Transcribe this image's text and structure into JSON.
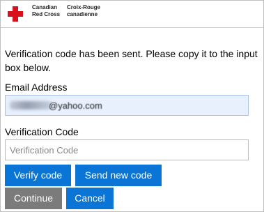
{
  "header": {
    "logo_line1_en": "Canadian",
    "logo_line2_en": "Red Cross",
    "logo_line1_fr": "Croix-Rouge",
    "logo_line2_fr": "canadienne",
    "logo_color": "#d6131b"
  },
  "message": "Verification code has been sent. Please copy it to the input box below.",
  "email": {
    "label": "Email Address",
    "value_visible": "@yahoo.com"
  },
  "verification": {
    "label": "Verification Code",
    "placeholder": "Verification Code",
    "value": ""
  },
  "buttons": {
    "verify_label": "Verify code",
    "send_new_label": "Send new code",
    "continue_label": "Continue",
    "cancel_label": "Cancel"
  },
  "colors": {
    "primary_button": "#0a75d4",
    "disabled_button": "#7b7b7b",
    "autofill_background": "#e8f0fe"
  }
}
